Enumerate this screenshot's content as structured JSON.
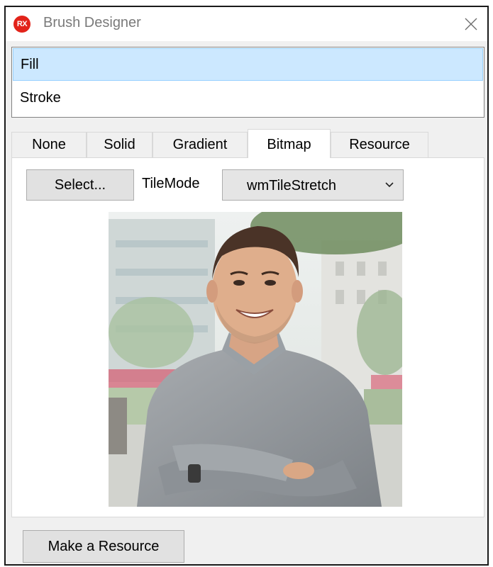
{
  "window": {
    "title": "Brush Designer",
    "app_icon_text": "RX",
    "accent_color": "#e2231a"
  },
  "targets": [
    {
      "label": "Fill",
      "selected": true
    },
    {
      "label": "Stroke",
      "selected": false
    }
  ],
  "tabs": [
    {
      "label": "None"
    },
    {
      "label": "Solid"
    },
    {
      "label": "Gradient"
    },
    {
      "label": "Bitmap",
      "active": true
    },
    {
      "label": "Resource"
    }
  ],
  "bitmap": {
    "select_label": "Select...",
    "tilemode_label": "TileMode",
    "tilemode_value": "wmTileStretch",
    "preview_image": "photo-of-smiling-man-in-gray-shirt"
  },
  "footer": {
    "make_resource_label": "Make a Resource"
  }
}
